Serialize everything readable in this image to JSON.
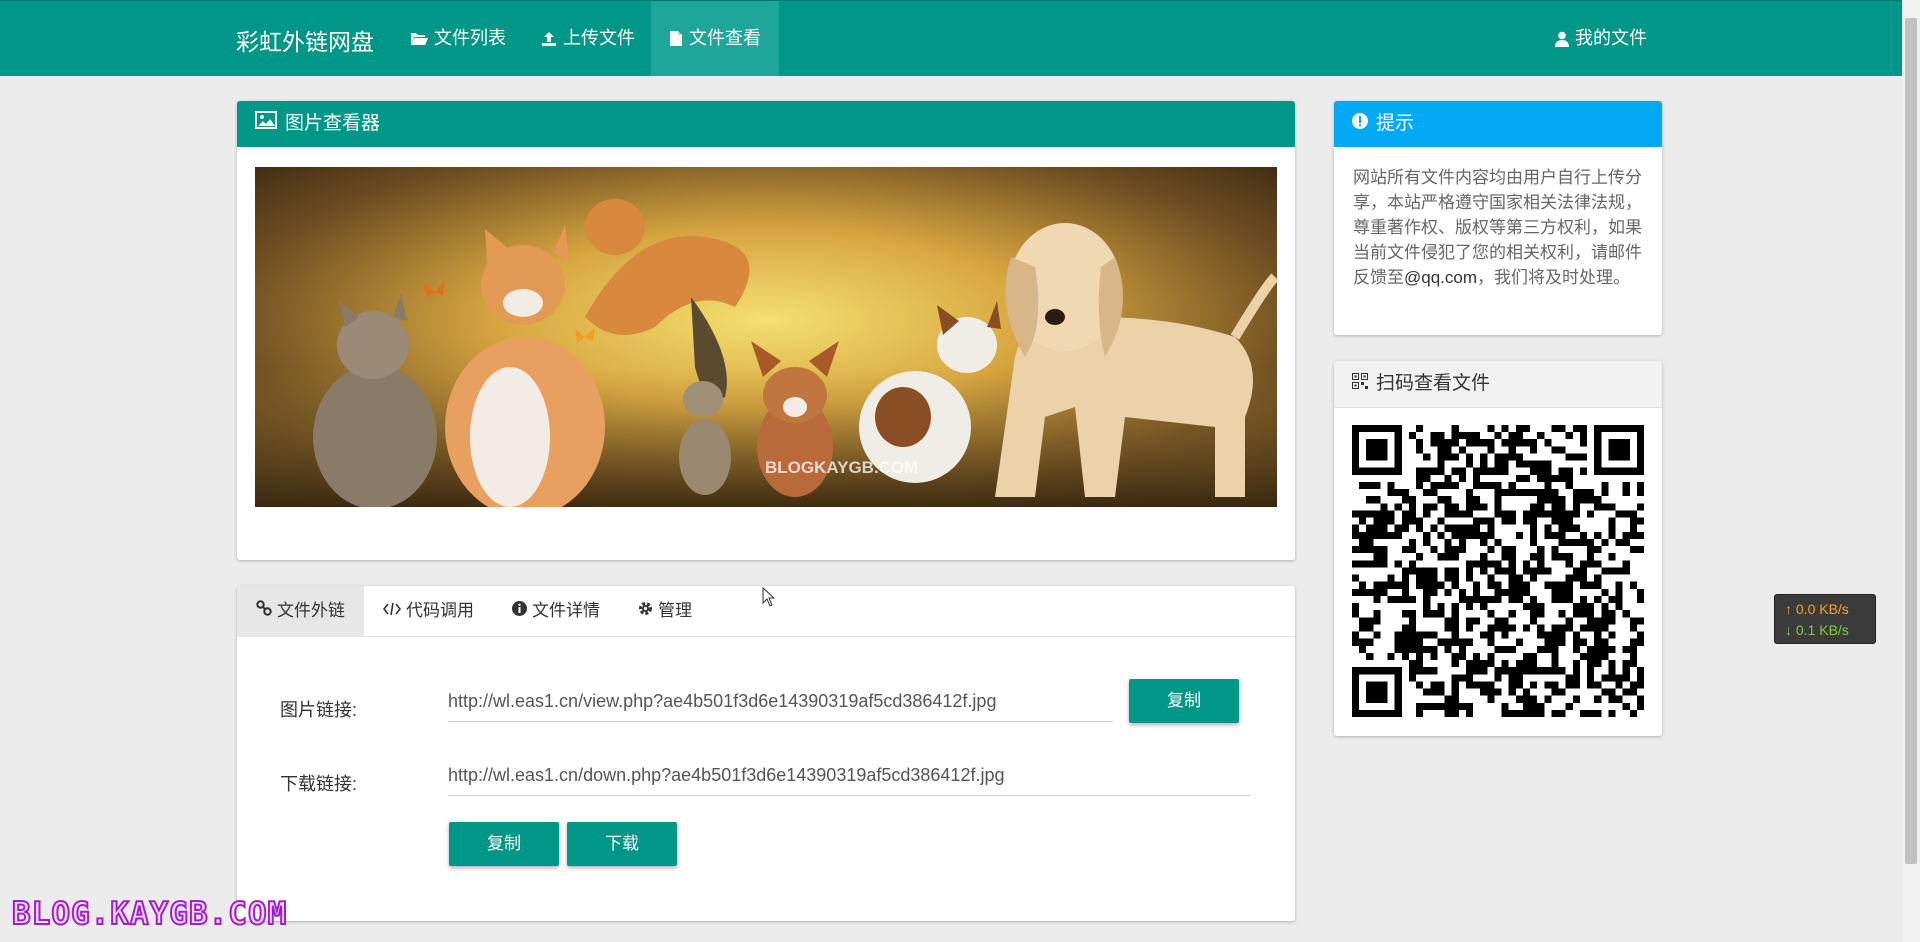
{
  "navbar": {
    "brand": "彩虹外链网盘",
    "items": [
      {
        "label": "文件列表",
        "icon": "folder-open-icon"
      },
      {
        "label": "上传文件",
        "icon": "upload-icon"
      },
      {
        "label": "文件查看",
        "icon": "file-icon",
        "active": true
      }
    ],
    "my_files": "我的文件"
  },
  "viewer": {
    "title": "图片查看器",
    "image_watermark": "BLOGKAYGB.COM"
  },
  "tabs": [
    {
      "label": "文件外链",
      "icon": "link-icon",
      "active": true
    },
    {
      "label": "代码调用",
      "icon": "code-icon"
    },
    {
      "label": "文件详情",
      "icon": "info-icon"
    },
    {
      "label": "管理",
      "icon": "gear-icon"
    }
  ],
  "links": {
    "image_label": "图片链接:",
    "image_url": "http://wl.eas1.cn/view.php?ae4b501f3d6e14390319af5cd386412f.jpg",
    "copy_label": "复制",
    "download_label": "下载链接:",
    "download_url": "http://wl.eas1.cn/down.php?ae4b501f3d6e14390319af5cd386412f.jpg",
    "copy2_label": "复制",
    "download_button": "下载"
  },
  "notice": {
    "title": "提示",
    "text_before": "网站所有文件内容均由用户自行上传分享，本站严格遵守国家相关法律法规，尊重著作权、版权等第三方权利，如果当前文件侵犯了您的相关权利，请邮件反馈至",
    "email": "@qq.com",
    "text_after": "，我们将及时处理。"
  },
  "qr": {
    "title": "扫码查看文件"
  },
  "speed": {
    "up": "0.0 KB/s",
    "down": "0.1 KB/s"
  },
  "watermark": "BLOG.KAYGB.COM",
  "colors": {
    "primary": "#009688",
    "info": "#03a9f4",
    "up_speed": "#f0a030",
    "down_speed": "#7ccc3c"
  }
}
